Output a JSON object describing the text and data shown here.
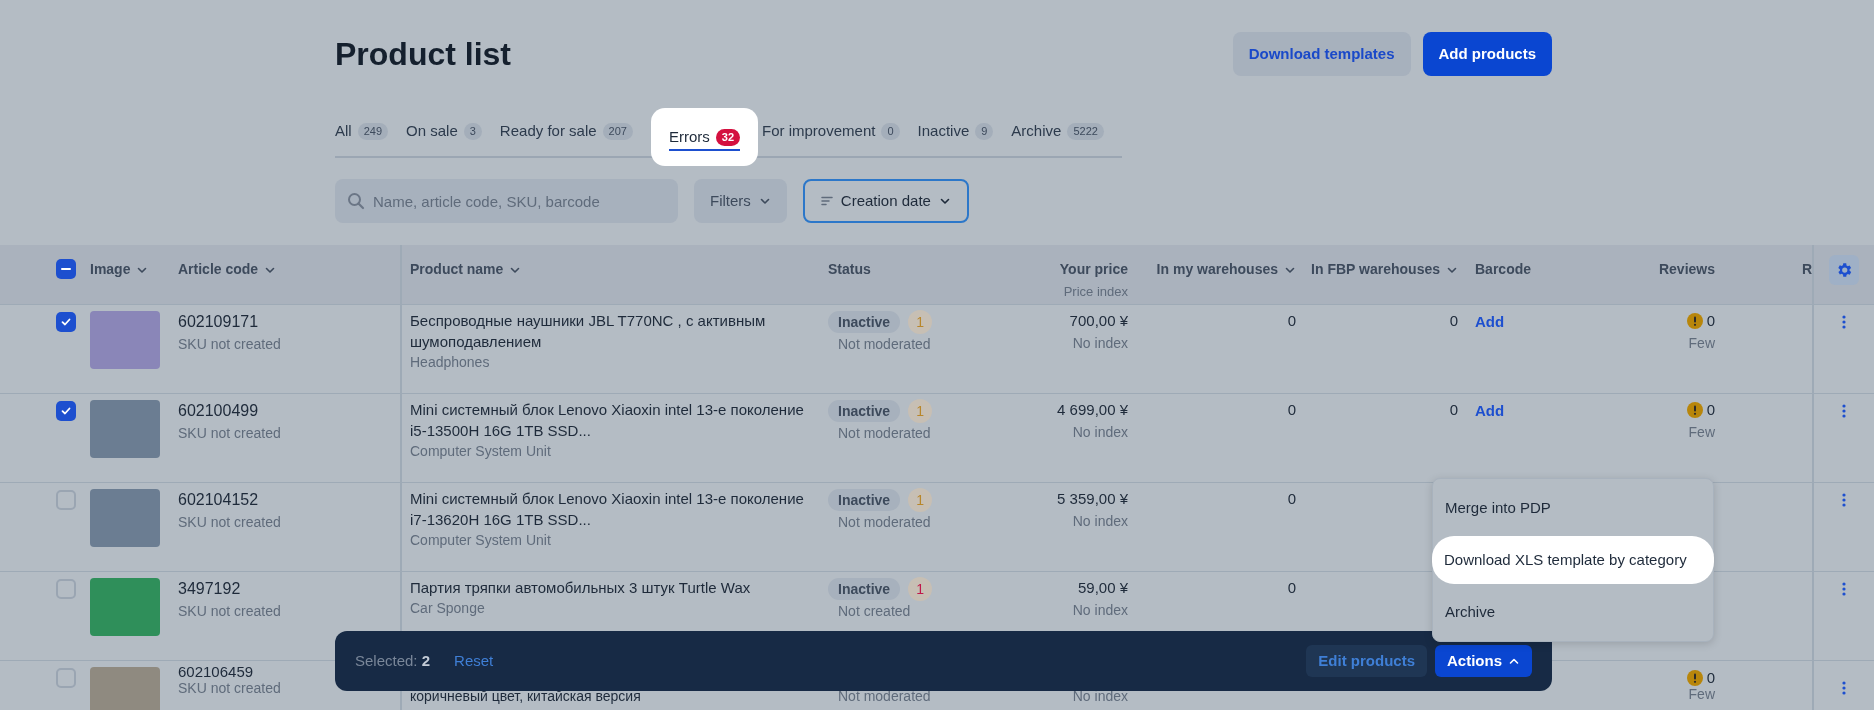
{
  "page": {
    "title": "Product list"
  },
  "header_buttons": [
    {
      "label": "Download templates",
      "kind": "secondary"
    },
    {
      "label": "Add products",
      "kind": "primary"
    }
  ],
  "tabs": [
    {
      "label": "All",
      "count": "249",
      "selected": false
    },
    {
      "label": "On sale",
      "count": "3",
      "selected": false
    },
    {
      "label": "Ready for sale",
      "count": "207",
      "selected": false
    },
    {
      "label": "Errors",
      "count": "32",
      "selected": true
    },
    {
      "label": "For improvement",
      "count": "0",
      "selected": false
    },
    {
      "label": "Inactive",
      "count": "9",
      "selected": false
    },
    {
      "label": "Archive",
      "count": "5222",
      "selected": false
    }
  ],
  "search": {
    "placeholder": "Name, article code, SKU, barcode"
  },
  "filters": [
    {
      "label": "Filters",
      "kind": "plain"
    },
    {
      "label": "Creation date",
      "kind": "sort"
    }
  ],
  "table": {
    "select_all": {
      "indeterminate": true
    },
    "columns": [
      {
        "label": "Image",
        "sortable": true
      },
      {
        "label": "Article code",
        "sortable": true
      },
      {
        "label": "Product name",
        "sortable": true
      },
      {
        "label": "Status",
        "sortable": false
      },
      {
        "label": "Your price",
        "sublabel": "Price index",
        "sortable": false
      },
      {
        "label": "In my warehouses",
        "sortable": true
      },
      {
        "label": "In FBP warehouses",
        "sortable": true
      },
      {
        "label": "Barcode",
        "sortable": false
      },
      {
        "label": "Reviews",
        "sortable": false
      },
      {
        "label": "R",
        "sortable": false
      }
    ],
    "rows": [
      {
        "checked": true,
        "article": "602109171",
        "sku_note": "SKU not created",
        "name": "Беспроводные наушники JBL T770NC , с активным шумоподавлением",
        "category": "Headphones",
        "status": "Inactive",
        "status_count": {
          "text": "1",
          "color": "#b8862a"
        },
        "status_note": "Not moderated",
        "price": "700,00 ¥",
        "price_index": "No index",
        "my_warehouses": "0",
        "fbp_warehouses": "0",
        "barcode": "Add",
        "reviews": "0",
        "reviews_note": "Few",
        "clipped_top": false
      },
      {
        "checked": true,
        "article": "602100499",
        "sku_note": "SKU not created",
        "name": "Mini системный блок Lenovo Xiaoxin intel 13-е поколение i5-13500H 16G 1TB SSD...",
        "category": "Computer System Unit",
        "status": "Inactive",
        "status_count": {
          "text": "1",
          "color": "#b8862a"
        },
        "status_note": "Not moderated",
        "price": "4 699,00 ¥",
        "price_index": "No index",
        "my_warehouses": "0",
        "fbp_warehouses": "0",
        "barcode": "Add",
        "reviews": "0",
        "reviews_note": "Few",
        "clipped_top": false
      },
      {
        "checked": false,
        "article": "602104152",
        "sku_note": "SKU not created",
        "name": "Mini системный блок Lenovo Xiaoxin intel 13-е поколение i7-13620H 16G 1TB SSD...",
        "category": "Computer System Unit",
        "status": "Inactive",
        "status_count": {
          "text": "1",
          "color": "#b8862a"
        },
        "status_note": "Not moderated",
        "price": "5 359,00 ¥",
        "price_index": "No index",
        "my_warehouses": "0",
        "clipped_top": false
      },
      {
        "checked": false,
        "article": "3497192",
        "sku_note": "SKU not created",
        "name": "Партия тряпки автомобильных 3 штук Turtle Wax",
        "category": "Car Sponge",
        "status": "Inactive",
        "status_count": {
          "text": "1",
          "color": "#c0184a"
        },
        "status_note": "Not created",
        "price": "59,00 ¥",
        "price_index": "No index",
        "my_warehouses": "0",
        "clipped_top": false
      },
      {
        "checked": false,
        "article": "602106459",
        "sku_note": "SKU not created",
        "name": "коричневый цвет, китайская версия",
        "status_note": "Not moderated",
        "price_index": "No index",
        "reviews": "0",
        "reviews_note": "Few",
        "clipped_top": true
      }
    ]
  },
  "selection_bar": {
    "selected_label": "Selected:",
    "selected_count": "2",
    "reset": "Reset",
    "buttons": [
      {
        "label": "Edit products",
        "kind": "secondary"
      },
      {
        "label": "Actions",
        "kind": "primary"
      }
    ]
  },
  "actions_menu": {
    "items": [
      {
        "label": "Merge into PDP",
        "highlighted": false
      },
      {
        "label": "Download XLS template by category",
        "highlighted": true
      },
      {
        "label": "Archive",
        "highlighted": false
      }
    ]
  }
}
